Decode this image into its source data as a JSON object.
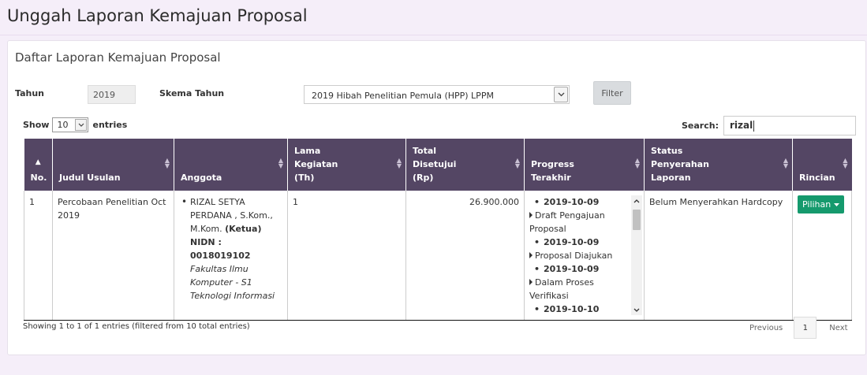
{
  "page": {
    "title": "Unggah Laporan Kemajuan Proposal"
  },
  "panel": {
    "title": "Daftar Laporan Kemajuan Proposal"
  },
  "filters": {
    "tahun_label": "Tahun",
    "tahun_value": "2019",
    "skema_label": "Skema Tahun",
    "skema_value": "2019 Hibah Penelitian Pemula (HPP) LPPM",
    "filter_button": "Filter"
  },
  "table_controls": {
    "show_label": "Show",
    "length_value": "10",
    "entries_label": "entries",
    "search_label": "Search:",
    "search_value": "rizal"
  },
  "table": {
    "columns": [
      "No.",
      "Judul Usulan",
      "Anggota",
      "Lama Kegiatan (Th)",
      "Total Disetujui (Rp)",
      "Progress Terakhir",
      "Status Penyerahan Laporan",
      "Rincian"
    ],
    "rows": [
      {
        "no": "1",
        "judul": "Percobaan Penelitian Oct 2019",
        "anggota": {
          "name": "RIZAL SETYA PERDANA , S.Kom., M.Kom.",
          "role": "(Ketua)",
          "nidn": "NIDN : 0018019102",
          "fakultas": "Fakultas Ilmu Komputer - S1 Teknologi Informasi"
        },
        "lama": "1",
        "total": "26.900.000",
        "progress": [
          {
            "date": "2019-10-09",
            "status": "Draft Pengajuan Proposal"
          },
          {
            "date": "2019-10-09",
            "status": "Proposal Diajukan"
          },
          {
            "date": "2019-10-09",
            "status": "Dalam Proses Verifikasi"
          },
          {
            "date": "2019-10-10",
            "status": ""
          }
        ],
        "status_penyerahan": "Belum Menyerahkan Hardcopy",
        "rincian_button": "Pilihan"
      }
    ]
  },
  "footer": {
    "info": "Showing 1 to 1 of 1 entries (filtered from 10 total entries)",
    "previous": "Previous",
    "current_page": "1",
    "next": "Next"
  },
  "colors": {
    "header_bg": "#544664",
    "page_bg": "#f5eef9",
    "pilihan_button": "#159a6d"
  }
}
